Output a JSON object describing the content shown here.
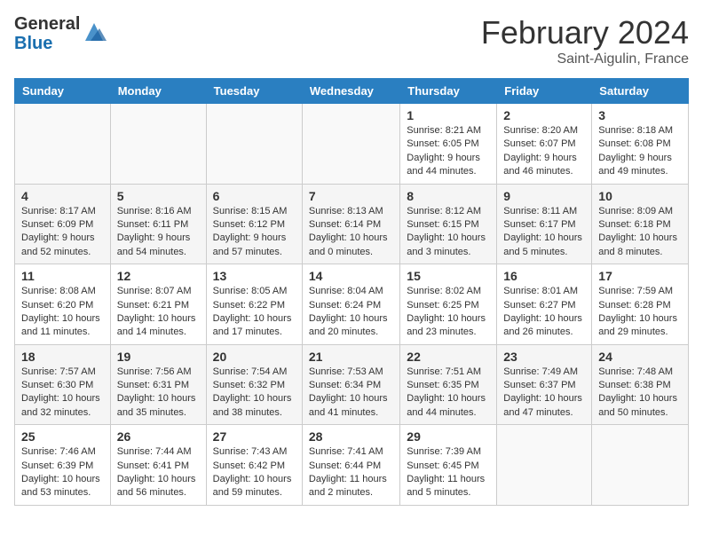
{
  "logo": {
    "general": "General",
    "blue": "Blue"
  },
  "title": {
    "month": "February 2024",
    "location": "Saint-Aigulin, France"
  },
  "days_of_week": [
    "Sunday",
    "Monday",
    "Tuesday",
    "Wednesday",
    "Thursday",
    "Friday",
    "Saturday"
  ],
  "weeks": [
    [
      {
        "day": "",
        "info": ""
      },
      {
        "day": "",
        "info": ""
      },
      {
        "day": "",
        "info": ""
      },
      {
        "day": "",
        "info": ""
      },
      {
        "day": "1",
        "info": "Sunrise: 8:21 AM\nSunset: 6:05 PM\nDaylight: 9 hours and 44 minutes."
      },
      {
        "day": "2",
        "info": "Sunrise: 8:20 AM\nSunset: 6:07 PM\nDaylight: 9 hours and 46 minutes."
      },
      {
        "day": "3",
        "info": "Sunrise: 8:18 AM\nSunset: 6:08 PM\nDaylight: 9 hours and 49 minutes."
      }
    ],
    [
      {
        "day": "4",
        "info": "Sunrise: 8:17 AM\nSunset: 6:09 PM\nDaylight: 9 hours and 52 minutes."
      },
      {
        "day": "5",
        "info": "Sunrise: 8:16 AM\nSunset: 6:11 PM\nDaylight: 9 hours and 54 minutes."
      },
      {
        "day": "6",
        "info": "Sunrise: 8:15 AM\nSunset: 6:12 PM\nDaylight: 9 hours and 57 minutes."
      },
      {
        "day": "7",
        "info": "Sunrise: 8:13 AM\nSunset: 6:14 PM\nDaylight: 10 hours and 0 minutes."
      },
      {
        "day": "8",
        "info": "Sunrise: 8:12 AM\nSunset: 6:15 PM\nDaylight: 10 hours and 3 minutes."
      },
      {
        "day": "9",
        "info": "Sunrise: 8:11 AM\nSunset: 6:17 PM\nDaylight: 10 hours and 5 minutes."
      },
      {
        "day": "10",
        "info": "Sunrise: 8:09 AM\nSunset: 6:18 PM\nDaylight: 10 hours and 8 minutes."
      }
    ],
    [
      {
        "day": "11",
        "info": "Sunrise: 8:08 AM\nSunset: 6:20 PM\nDaylight: 10 hours and 11 minutes."
      },
      {
        "day": "12",
        "info": "Sunrise: 8:07 AM\nSunset: 6:21 PM\nDaylight: 10 hours and 14 minutes."
      },
      {
        "day": "13",
        "info": "Sunrise: 8:05 AM\nSunset: 6:22 PM\nDaylight: 10 hours and 17 minutes."
      },
      {
        "day": "14",
        "info": "Sunrise: 8:04 AM\nSunset: 6:24 PM\nDaylight: 10 hours and 20 minutes."
      },
      {
        "day": "15",
        "info": "Sunrise: 8:02 AM\nSunset: 6:25 PM\nDaylight: 10 hours and 23 minutes."
      },
      {
        "day": "16",
        "info": "Sunrise: 8:01 AM\nSunset: 6:27 PM\nDaylight: 10 hours and 26 minutes."
      },
      {
        "day": "17",
        "info": "Sunrise: 7:59 AM\nSunset: 6:28 PM\nDaylight: 10 hours and 29 minutes."
      }
    ],
    [
      {
        "day": "18",
        "info": "Sunrise: 7:57 AM\nSunset: 6:30 PM\nDaylight: 10 hours and 32 minutes."
      },
      {
        "day": "19",
        "info": "Sunrise: 7:56 AM\nSunset: 6:31 PM\nDaylight: 10 hours and 35 minutes."
      },
      {
        "day": "20",
        "info": "Sunrise: 7:54 AM\nSunset: 6:32 PM\nDaylight: 10 hours and 38 minutes."
      },
      {
        "day": "21",
        "info": "Sunrise: 7:53 AM\nSunset: 6:34 PM\nDaylight: 10 hours and 41 minutes."
      },
      {
        "day": "22",
        "info": "Sunrise: 7:51 AM\nSunset: 6:35 PM\nDaylight: 10 hours and 44 minutes."
      },
      {
        "day": "23",
        "info": "Sunrise: 7:49 AM\nSunset: 6:37 PM\nDaylight: 10 hours and 47 minutes."
      },
      {
        "day": "24",
        "info": "Sunrise: 7:48 AM\nSunset: 6:38 PM\nDaylight: 10 hours and 50 minutes."
      }
    ],
    [
      {
        "day": "25",
        "info": "Sunrise: 7:46 AM\nSunset: 6:39 PM\nDaylight: 10 hours and 53 minutes."
      },
      {
        "day": "26",
        "info": "Sunrise: 7:44 AM\nSunset: 6:41 PM\nDaylight: 10 hours and 56 minutes."
      },
      {
        "day": "27",
        "info": "Sunrise: 7:43 AM\nSunset: 6:42 PM\nDaylight: 10 hours and 59 minutes."
      },
      {
        "day": "28",
        "info": "Sunrise: 7:41 AM\nSunset: 6:44 PM\nDaylight: 11 hours and 2 minutes."
      },
      {
        "day": "29",
        "info": "Sunrise: 7:39 AM\nSunset: 6:45 PM\nDaylight: 11 hours and 5 minutes."
      },
      {
        "day": "",
        "info": ""
      },
      {
        "day": "",
        "info": ""
      }
    ]
  ]
}
